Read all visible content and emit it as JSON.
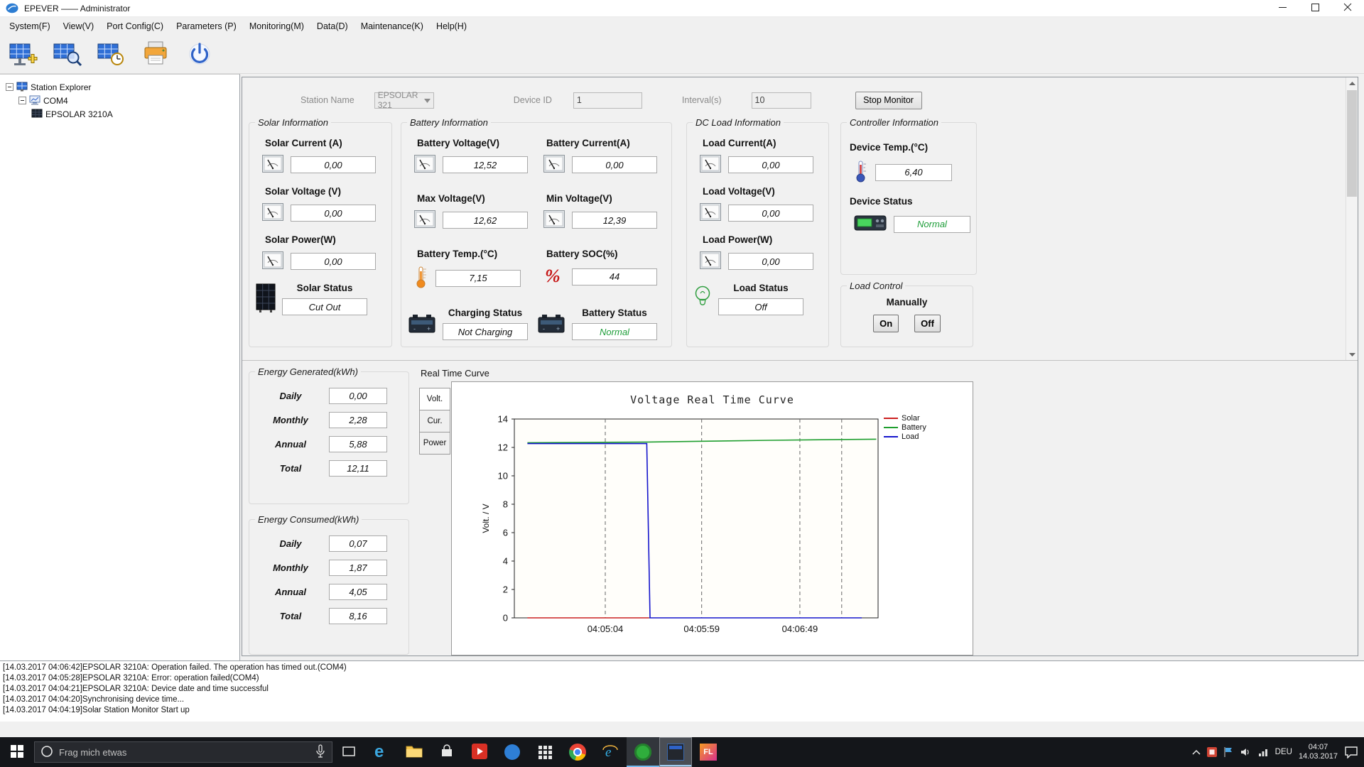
{
  "colors": {
    "status_ok": "#1f9e3a"
  },
  "window": {
    "title": "EPEVER —— Administrator"
  },
  "menu": {
    "items": [
      "System(F)",
      "View(V)",
      "Port Config(C)",
      "Parameters (P)",
      "Monitoring(M)",
      "Data(D)",
      "Maintenance(K)",
      "Help(H)"
    ]
  },
  "tree": {
    "root": "Station Explorer",
    "com": "COM4",
    "device": "EPSOLAR 3210A"
  },
  "monitor": {
    "station_name_label": "Station Name",
    "station_name_value": "EPSOLAR 321",
    "device_id_label": "Device ID",
    "device_id_value": "1",
    "interval_label": "Interval(s)",
    "interval_value": "10",
    "stop_button": "Stop Monitor"
  },
  "solar": {
    "group_title": "Solar Information",
    "fields": [
      {
        "label": "Solar Current (A)",
        "value": "0,00"
      },
      {
        "label": "Solar Voltage (V)",
        "value": "0,00"
      },
      {
        "label": "Solar Power(W)",
        "value": "0,00"
      }
    ],
    "status_label": "Solar Status",
    "status_value": "Cut Out"
  },
  "battery": {
    "group_title": "Battery Information",
    "fields": [
      {
        "label": "Battery Voltage(V)",
        "value": "12,52"
      },
      {
        "label": "Battery Current(A)",
        "value": "0,00"
      },
      {
        "label": "Max Voltage(V)",
        "value": "12,62"
      },
      {
        "label": "Min Voltage(V)",
        "value": "12,39"
      },
      {
        "label": "Battery Temp.(°C)",
        "value": "7,15"
      },
      {
        "label": "Battery SOC(%)",
        "value": "44"
      }
    ],
    "charging_status_label": "Charging Status",
    "charging_status_value": "Not Charging",
    "battery_status_label": "Battery Status",
    "battery_status_value": "Normal"
  },
  "dc_load": {
    "group_title": "DC Load Information",
    "fields": [
      {
        "label": "Load Current(A)",
        "value": "0,00"
      },
      {
        "label": "Load Voltage(V)",
        "value": "0,00"
      },
      {
        "label": "Load Power(W)",
        "value": "0,00"
      }
    ],
    "status_label": "Load Status",
    "status_value": "Off"
  },
  "controller": {
    "group_title": "Controller Information",
    "temp_label": "Device Temp.(°C)",
    "temp_value": "6,40",
    "status_label": "Device Status",
    "status_value": "Normal"
  },
  "load_control": {
    "group_title": "Load Control",
    "manually_label": "Manually",
    "on_button": "On",
    "off_button": "Off"
  },
  "energy_generated": {
    "group_title": "Energy Generated(kWh)",
    "rows": [
      {
        "label": "Daily",
        "value": "0,00"
      },
      {
        "label": "Monthly",
        "value": "2,28"
      },
      {
        "label": "Annual",
        "value": "5,88"
      },
      {
        "label": "Total",
        "value": "12,11"
      }
    ]
  },
  "energy_consumed": {
    "group_title": "Energy Consumed(kWh)",
    "rows": [
      {
        "label": "Daily",
        "value": "0,07"
      },
      {
        "label": "Monthly",
        "value": "1,87"
      },
      {
        "label": "Annual",
        "value": "4,05"
      },
      {
        "label": "Total",
        "value": "8,16"
      }
    ]
  },
  "curve": {
    "panel_title": "Real Time Curve",
    "tabs": [
      "Volt.",
      "Cur.",
      "Power"
    ],
    "active_tab": "Volt."
  },
  "chart_data": {
    "type": "line",
    "title": "Voltage Real Time Curve",
    "ylabel": "Volt. / V",
    "ylim": [
      0,
      14
    ],
    "yticks": [
      0,
      2,
      4,
      6,
      8,
      10,
      12,
      14
    ],
    "x_gridlines": [
      {
        "pos": 25,
        "label": "04:05:04"
      },
      {
        "pos": 51.5,
        "label": "04:05:59"
      },
      {
        "pos": 78.5,
        "label": "04:06:49"
      },
      {
        "pos": 90,
        "label": ""
      }
    ],
    "legend_position": "right",
    "series": [
      {
        "name": "Solar",
        "color": "#cc2020",
        "points": [
          [
            3.6,
            0
          ],
          [
            37,
            0
          ]
        ]
      },
      {
        "name": "Battery",
        "color": "#1e9e2e",
        "points": [
          [
            3.6,
            12.33
          ],
          [
            36.5,
            12.38
          ],
          [
            70,
            12.5
          ],
          [
            99.5,
            12.58
          ]
        ]
      },
      {
        "name": "Load",
        "color": "#1515cc",
        "points": [
          [
            3.6,
            12.27
          ],
          [
            36.4,
            12.27
          ],
          [
            37.3,
            0
          ],
          [
            95.5,
            0
          ]
        ]
      }
    ]
  },
  "log": {
    "lines": [
      "[14.03.2017 04:06:42]EPSOLAR 3210A: Operation failed. The operation has timed out.(COM4)",
      "[14.03.2017 04:05:28]EPSOLAR 3210A: Error: operation failed(COM4)",
      "[14.03.2017 04:04:21]EPSOLAR 3210A: Device date and time successful",
      "[14.03.2017 04:04:20]Synchronising device time...",
      "[14.03.2017 04:04:19]Solar Station Monitor Start up"
    ]
  },
  "taskbar": {
    "search_placeholder": "Frag mich etwas",
    "language": "DEU",
    "time": "04:07",
    "date": "14.03.2017"
  }
}
